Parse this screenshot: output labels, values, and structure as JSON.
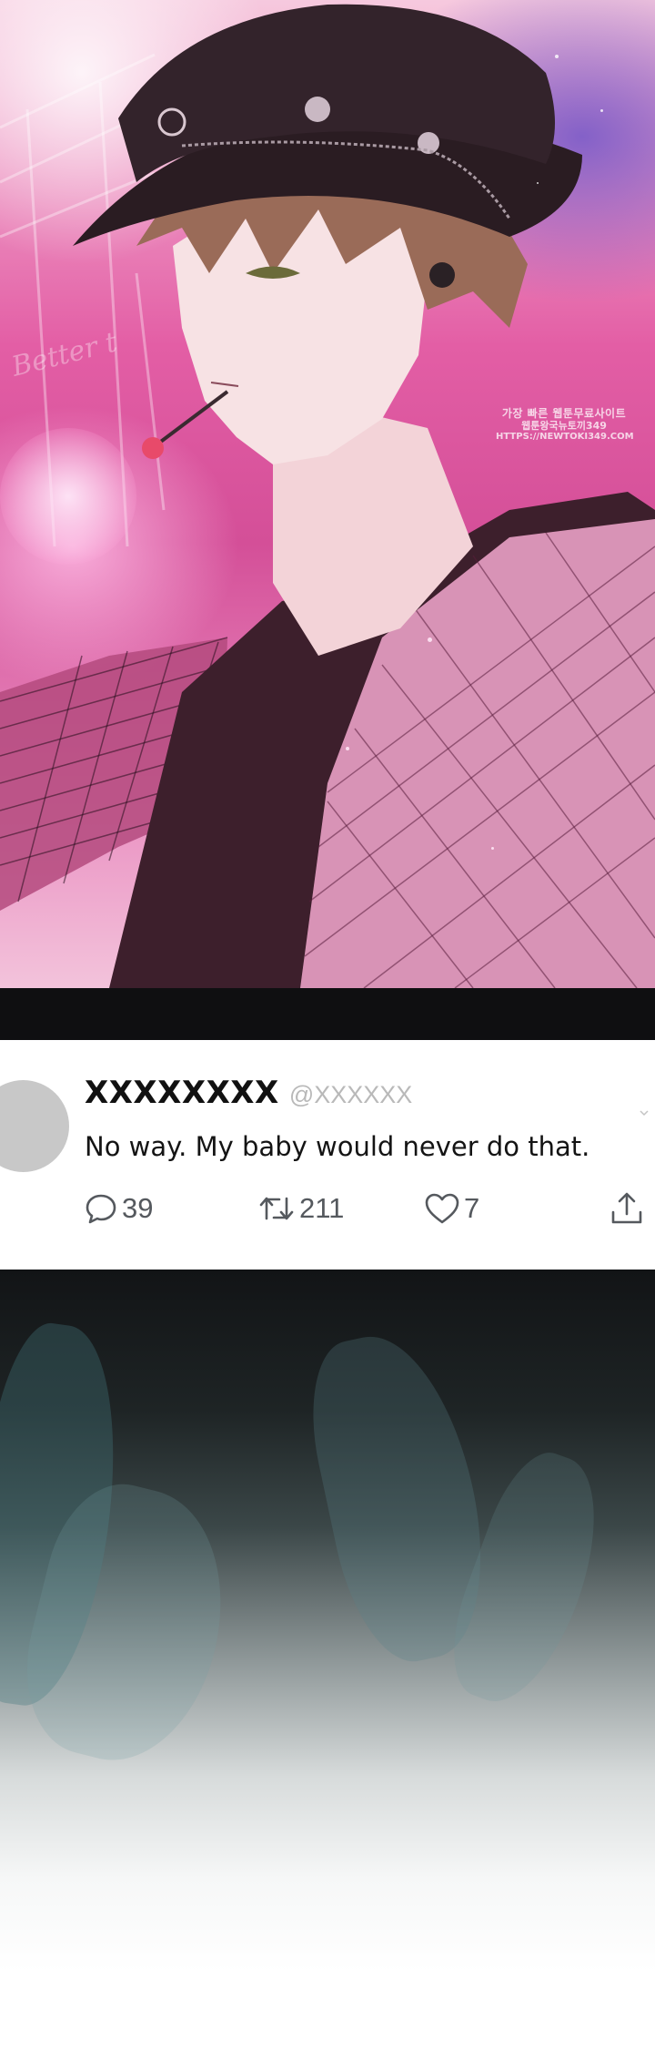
{
  "panel_art": {
    "background_text": "Better t",
    "watermark": {
      "line1": "가장 빠른 웹툰무료사이트",
      "line2": "웹툰왕국뉴토끼349",
      "line3": "HTTPS://NEWTOKI349.COM"
    }
  },
  "tweet": {
    "display_name": "XXXXXXXX",
    "handle": "@XXXXXX",
    "text": "No way. My baby would never do that.",
    "replies": "39",
    "retweets": "211",
    "likes": "7",
    "icons": {
      "reply": "speech-bubble-icon",
      "retweet": "retweet-arrows-icon",
      "like": "heart-icon",
      "share": "share-upload-icon",
      "more": "chevron-down-icon"
    },
    "colors": {
      "name": "#111111",
      "handle": "#b9b9b9",
      "text": "#141414",
      "icons": "#55595e",
      "avatar": "#c8c8c8"
    }
  },
  "colors": {
    "divider": "#0f0f11",
    "page_background": "#ffffff"
  }
}
